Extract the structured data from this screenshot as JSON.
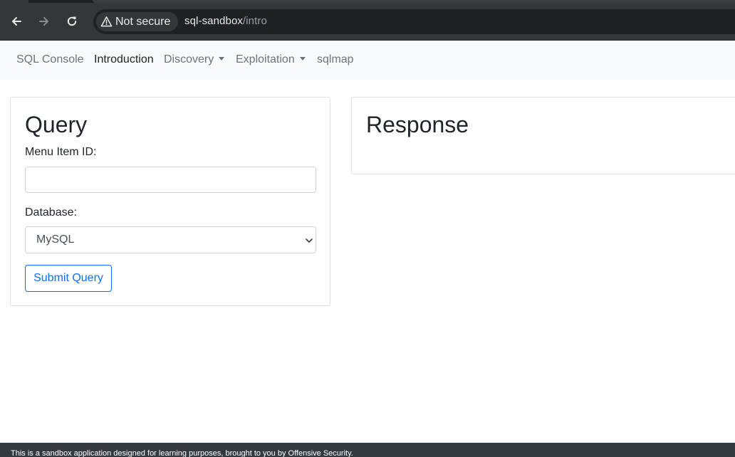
{
  "browser": {
    "security_label": "Not secure",
    "url_host": "sql-sandbox",
    "url_path": "/intro",
    "icons": [
      "back-arrow-icon",
      "forward-arrow-icon",
      "reload-icon",
      "warning-triangle-icon"
    ]
  },
  "navbar": {
    "brand": "SQL Console",
    "items": [
      {
        "label": "Introduction",
        "active": true
      },
      {
        "label": "Discovery",
        "dropdown": true
      },
      {
        "label": "Exploitation",
        "dropdown": true
      },
      {
        "label": "sqlmap"
      }
    ]
  },
  "query_card": {
    "title": "Query",
    "menu_item_label": "Menu Item ID:",
    "menu_item_value": "",
    "database_label": "Database:",
    "database_selected": "MySQL",
    "submit_label": "Submit Query"
  },
  "response_card": {
    "title": "Response"
  },
  "footer": {
    "text": "This is a sandbox application designed for learning purposes, brought to you by Offensive Security."
  },
  "colors": {
    "chrome_bg": "#35363a",
    "navbar_bg": "#f8f9fa",
    "primary": "#0d6efd",
    "footer_bg": "#343a40"
  }
}
